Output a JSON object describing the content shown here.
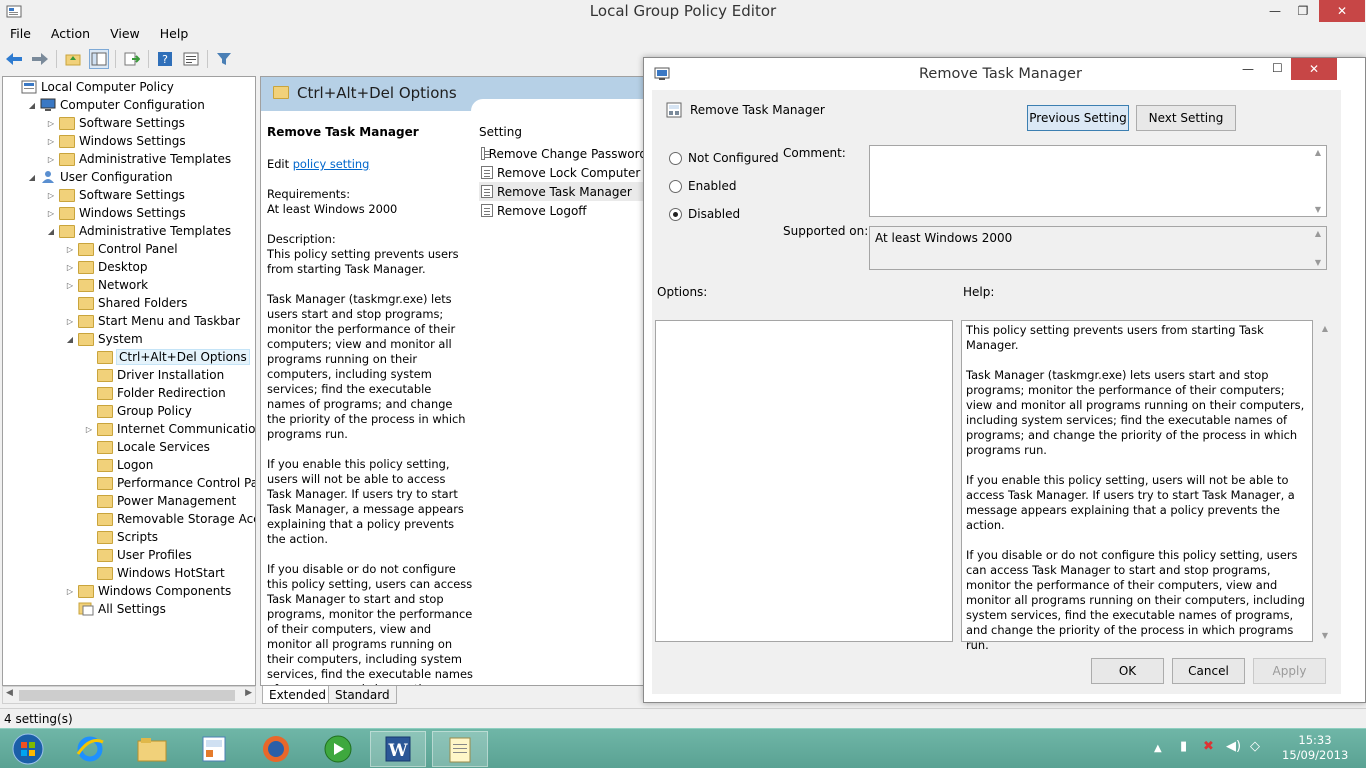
{
  "window": {
    "title": "Local Group Policy Editor",
    "minimize": "—",
    "maximize": "❐",
    "close": "✕"
  },
  "menu": [
    "File",
    "Action",
    "View",
    "Help"
  ],
  "tree": [
    {
      "label": "Local Computer Policy",
      "indent": 0,
      "arrow": "",
      "icon": "policy-icon"
    },
    {
      "label": "Computer Configuration",
      "indent": 1,
      "arrow": "◢",
      "icon": "computer-icon"
    },
    {
      "label": "Software Settings",
      "indent": 2,
      "arrow": "▷",
      "icon": "folder-icon"
    },
    {
      "label": "Windows Settings",
      "indent": 2,
      "arrow": "▷",
      "icon": "folder-icon"
    },
    {
      "label": "Administrative Templates",
      "indent": 2,
      "arrow": "▷",
      "icon": "folder-icon"
    },
    {
      "label": "User Configuration",
      "indent": 1,
      "arrow": "◢",
      "icon": "user-icon"
    },
    {
      "label": "Software Settings",
      "indent": 2,
      "arrow": "▷",
      "icon": "folder-icon"
    },
    {
      "label": "Windows Settings",
      "indent": 2,
      "arrow": "▷",
      "icon": "folder-icon"
    },
    {
      "label": "Administrative Templates",
      "indent": 2,
      "arrow": "◢",
      "icon": "folder-icon"
    },
    {
      "label": "Control Panel",
      "indent": 3,
      "arrow": "▷",
      "icon": "folder-icon"
    },
    {
      "label": "Desktop",
      "indent": 3,
      "arrow": "▷",
      "icon": "folder-icon"
    },
    {
      "label": "Network",
      "indent": 3,
      "arrow": "▷",
      "icon": "folder-icon"
    },
    {
      "label": "Shared Folders",
      "indent": 3,
      "arrow": "",
      "icon": "folder-icon"
    },
    {
      "label": "Start Menu and Taskbar",
      "indent": 3,
      "arrow": "▷",
      "icon": "folder-icon"
    },
    {
      "label": "System",
      "indent": 3,
      "arrow": "◢",
      "icon": "folder-icon"
    },
    {
      "label": "Ctrl+Alt+Del Options",
      "indent": 4,
      "arrow": "",
      "icon": "folder-icon",
      "selected": true
    },
    {
      "label": "Driver Installation",
      "indent": 4,
      "arrow": "",
      "icon": "folder-icon"
    },
    {
      "label": "Folder Redirection",
      "indent": 4,
      "arrow": "",
      "icon": "folder-icon"
    },
    {
      "label": "Group Policy",
      "indent": 4,
      "arrow": "",
      "icon": "folder-icon"
    },
    {
      "label": "Internet Communication Ma",
      "indent": 4,
      "arrow": "▷",
      "icon": "folder-icon"
    },
    {
      "label": "Locale Services",
      "indent": 4,
      "arrow": "",
      "icon": "folder-icon"
    },
    {
      "label": "Logon",
      "indent": 4,
      "arrow": "",
      "icon": "folder-icon"
    },
    {
      "label": "Performance Control Panel",
      "indent": 4,
      "arrow": "",
      "icon": "folder-icon"
    },
    {
      "label": "Power Management",
      "indent": 4,
      "arrow": "",
      "icon": "folder-icon"
    },
    {
      "label": "Removable Storage Access",
      "indent": 4,
      "arrow": "",
      "icon": "folder-icon"
    },
    {
      "label": "Scripts",
      "indent": 4,
      "arrow": "",
      "icon": "folder-icon"
    },
    {
      "label": "User Profiles",
      "indent": 4,
      "arrow": "",
      "icon": "folder-icon"
    },
    {
      "label": "Windows HotStart",
      "indent": 4,
      "arrow": "",
      "icon": "folder-icon"
    },
    {
      "label": "Windows Components",
      "indent": 3,
      "arrow": "▷",
      "icon": "folder-icon"
    },
    {
      "label": "All Settings",
      "indent": 3,
      "arrow": "",
      "icon": "all-settings-icon"
    }
  ],
  "content": {
    "header": "Ctrl+Alt+Del Options",
    "policy_title": "Remove Task Manager",
    "edit_prefix": "Edit",
    "edit_link": "policy setting",
    "requirements_label": "Requirements:",
    "requirements_value": "At least Windows 2000",
    "description_label": "Description:",
    "description_1": "This policy setting prevents users from starting Task Manager.",
    "description_2": "Task Manager (taskmgr.exe) lets users start and stop programs; monitor the performance of their computers; view and monitor all programs running on their computers, including system services; find the executable names of programs; and change the priority of the process in which programs run.",
    "description_3": "If you enable this policy setting, users will not be able to access Task Manager. If users try to start Task Manager, a message appears explaining that a policy prevents the action.",
    "description_4": "If you disable or do not configure this policy setting, users can access Task Manager to  start and stop programs, monitor the performance of their computers, view and monitor all programs running on their computers, including system services, find the executable names of programs, and change the priority of the process in which programs run.",
    "setting_header": "Setting",
    "settings": [
      "Remove Change Password",
      "Remove Lock Computer",
      "Remove Task Manager",
      "Remove Logoff"
    ],
    "selected_setting": 2,
    "tabs": [
      "Extended",
      "Standard"
    ]
  },
  "status": "4 setting(s)",
  "dialog": {
    "title": "Remove Task Manager",
    "policy_name": "Remove Task Manager",
    "prev_button": "Previous Setting",
    "next_button": "Next Setting",
    "options": [
      "Not Configured",
      "Enabled",
      "Disabled"
    ],
    "selected_option": "Disabled",
    "comment_label": "Comment:",
    "comment_value": "",
    "supported_label": "Supported on:",
    "supported_value": "At least Windows 2000",
    "options_label": "Options:",
    "help_label": "Help:",
    "help_1": "This policy setting prevents users from starting Task Manager.",
    "help_2": "Task Manager (taskmgr.exe) lets users start and stop programs; monitor the performance of their computers; view and monitor all programs running on their computers, including system services; find the executable names of programs; and change the priority of the process in which programs run.",
    "help_3": "If you enable this policy setting, users will not be able to access Task Manager. If users try to start Task Manager, a message appears explaining that a policy prevents the action.",
    "help_4": "If you disable or do not configure this policy setting, users can access Task Manager to  start and stop programs, monitor the performance of their computers, view and monitor all programs running on their computers, including system services, find the executable names of programs, and change the priority of the process in which programs run.",
    "ok": "OK",
    "cancel": "Cancel",
    "apply": "Apply"
  },
  "taskbar": {
    "apps": [
      "start-orb-icon",
      "internet-explorer-icon",
      "file-explorer-icon",
      "control-panel-icon",
      "firefox-icon",
      "media-center-icon",
      "word-icon",
      "notepad-icon"
    ],
    "time": "15:33",
    "date": "15/09/2013"
  },
  "colors": {
    "header_blue": "#b6d0e6",
    "close_red": "#c74646",
    "taskbar": "#5aa293",
    "link": "#0066cc"
  }
}
